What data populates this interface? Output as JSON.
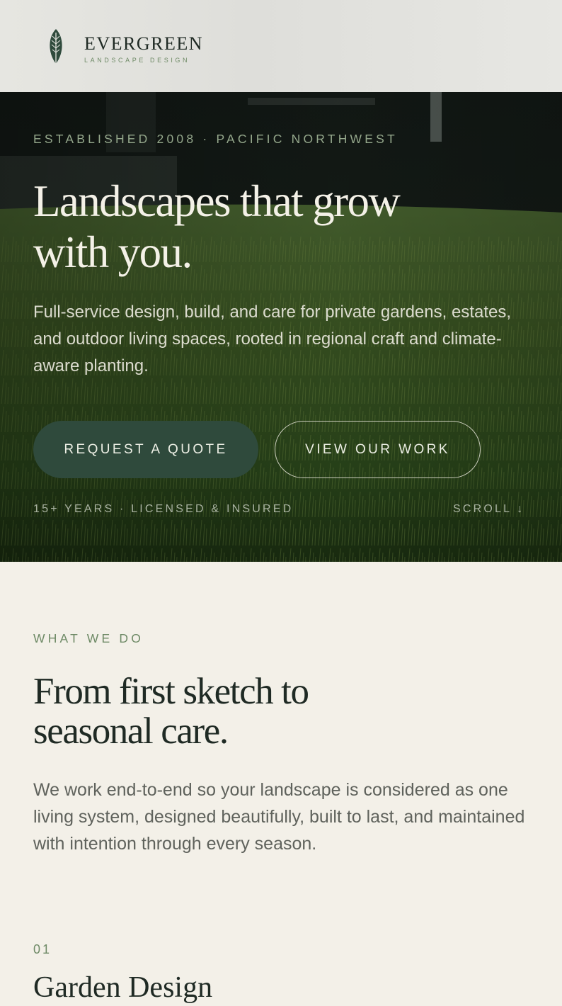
{
  "brand": {
    "name": "EVERGREEN",
    "tagline": "LANDSCAPE DESIGN",
    "icon": "leaf-icon",
    "color": "#2f4a3c"
  },
  "hero": {
    "eyebrow": "ESTABLISHED 2008 · PACIFIC NORTHWEST",
    "title_line1": "Landscapes that grow",
    "title_line2": "with you.",
    "text": "Full-service design, build, and care for private gardens, estates, and outdoor living spaces, rooted in regional craft and climate-aware planting.",
    "primary_cta": "REQUEST A QUOTE",
    "secondary_cta": "VIEW OUR WORK",
    "meta": "15+ YEARS · LICENSED & INSURED",
    "scroll": "SCROLL ↓"
  },
  "services": {
    "eyebrow": "WHAT WE DO",
    "title_line1": "From first sketch to",
    "title_line2": "seasonal care.",
    "text": "We work end-to-end so your landscape is considered as one living system, designed beautifully, built to last, and maintained with intention through every season.",
    "items": [
      {
        "number": "01",
        "title": "Garden Design"
      }
    ]
  },
  "colors": {
    "accent": "#2f4a3c",
    "eyebrow": "#6e8a66",
    "background": "#f3f0e8",
    "ink": "#1f2a24"
  }
}
